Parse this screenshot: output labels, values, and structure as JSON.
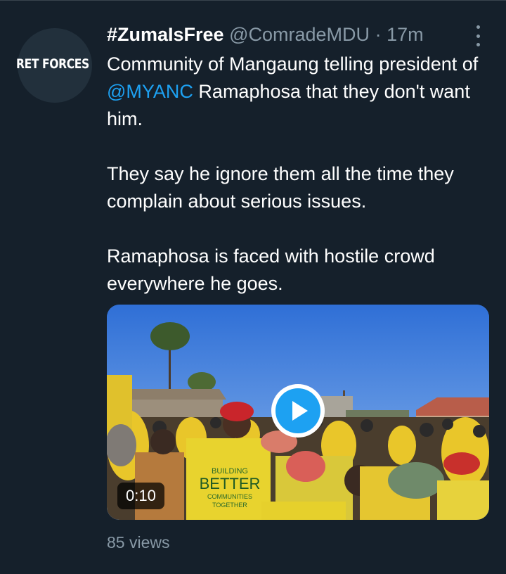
{
  "tweet": {
    "avatar_text": "RET FORCES",
    "display_name": "#ZumaIsFree",
    "handle": "@ComradeMDU",
    "separator": "·",
    "time": "17m",
    "body": {
      "line1_before": "Community of Mangaung telling president of ",
      "mention": "@MYANC",
      "line1_after": " Ramaphosa that they don't want him.",
      "para2": "They say he ignore them all the time they complain about serious issues.",
      "para3": "Ramaphosa is faced with hostile crowd everywhere he goes."
    },
    "media": {
      "duration": "0:10",
      "shirt_text_1": "BUILDING",
      "shirt_text_2": "BETTER",
      "shirt_text_3": "COMMUNITIES",
      "shirt_text_4": "TOGETHER"
    },
    "views": "85 views"
  },
  "colors": {
    "background": "#15202b",
    "secondary_text": "#8899a6",
    "accent": "#1da1f2"
  },
  "icons": {
    "more": "more-vertical-icon",
    "play": "play-icon"
  }
}
